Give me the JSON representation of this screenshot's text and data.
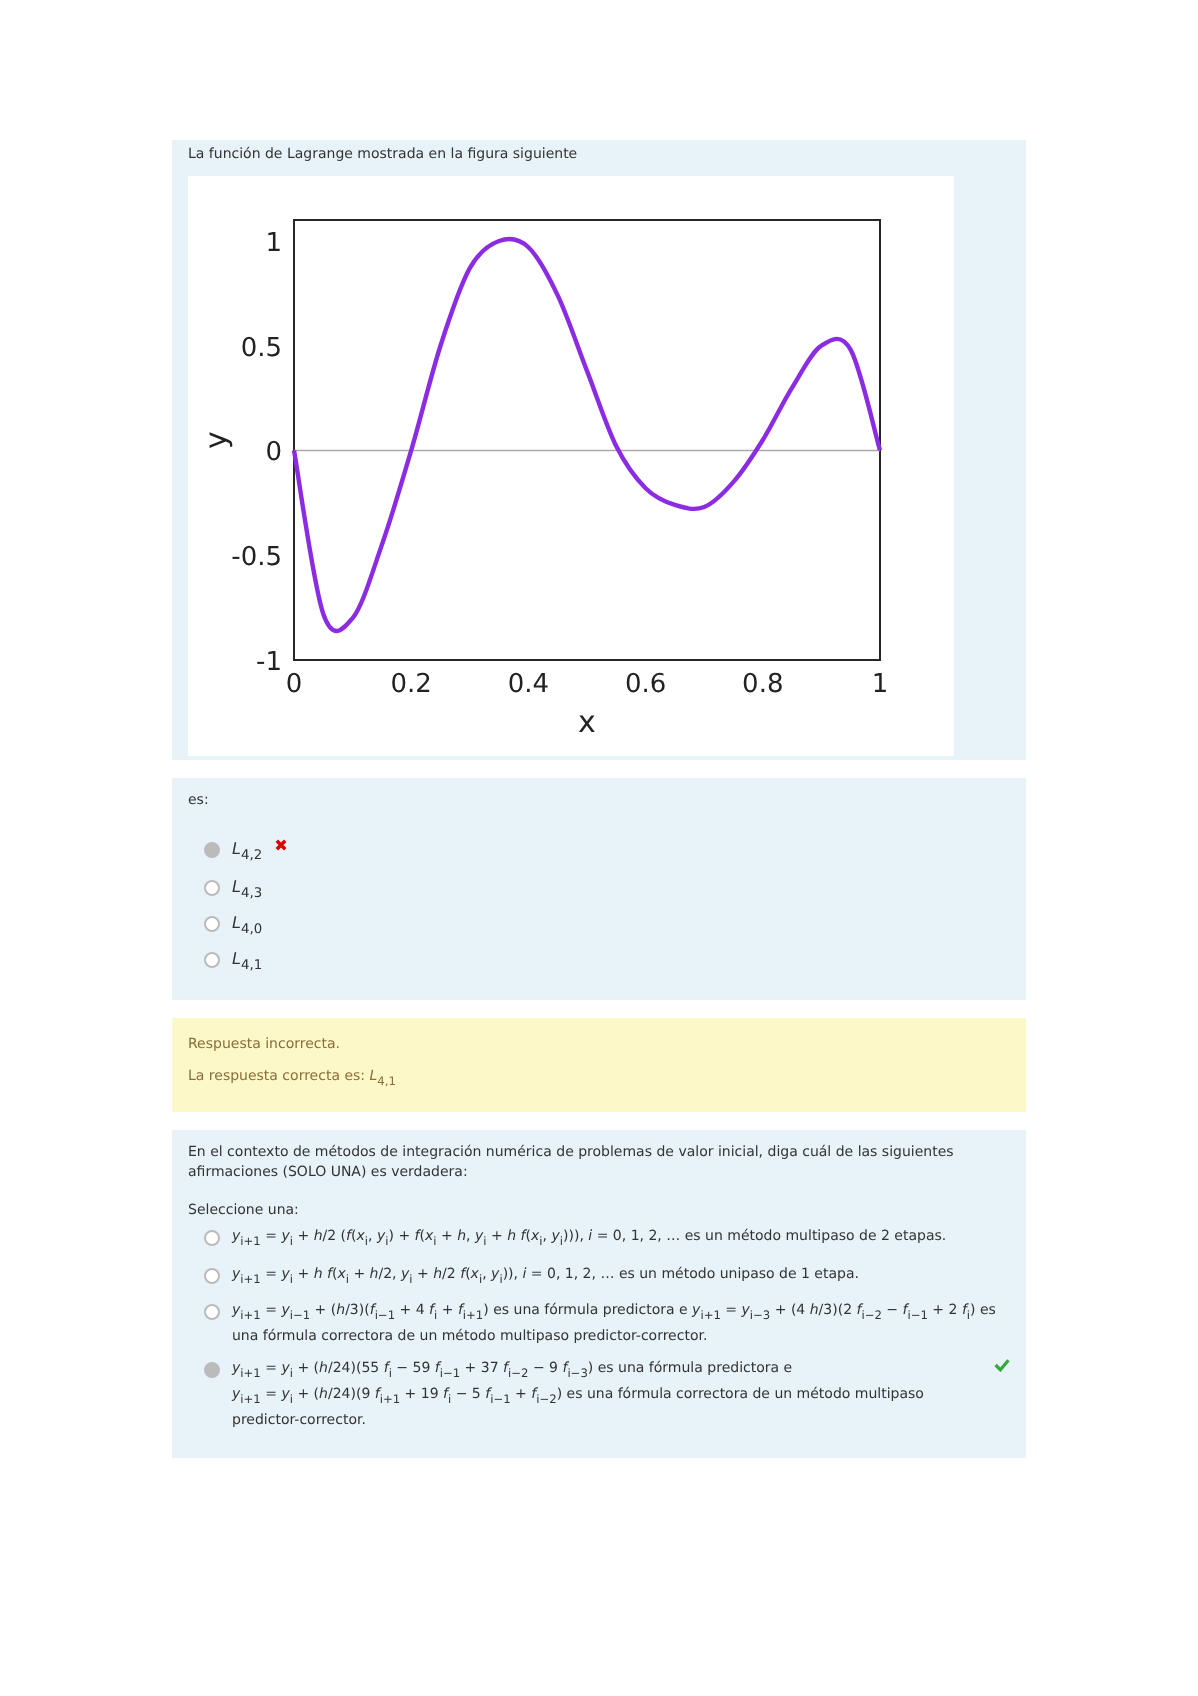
{
  "question_1": {
    "prompt": "La función de Lagrange mostrada en la figura siguiente",
    "figure": {
      "chart_data": {
        "type": "line",
        "xlabel": "x",
        "ylabel": "y",
        "x": [
          0,
          0.05,
          0.1,
          0.15,
          0.2,
          0.25,
          0.3,
          0.35,
          0.4,
          0.45,
          0.5,
          0.55,
          0.6,
          0.65,
          0.7,
          0.75,
          0.8,
          0.85,
          0.9,
          0.95,
          1
        ],
        "series": [
          {
            "color": "#8b2be2",
            "values": [
              0,
              -0.78,
              -0.8,
              -0.45,
              0,
              0.5,
              0.87,
              1.0,
              0.97,
              0.74,
              0.38,
              0.02,
              -0.18,
              -0.26,
              -0.27,
              -0.15,
              0.05,
              0.3,
              0.5,
              0.48,
              0
            ]
          }
        ],
        "xlim": [
          0,
          1
        ],
        "ylim": [
          -1,
          1.1
        ],
        "xticks": [
          0,
          0.2,
          0.4,
          0.6,
          0.8,
          1
        ],
        "yticks": [
          -1,
          -0.5,
          0,
          0.5,
          1
        ]
      }
    }
  },
  "question_1_answers": {
    "lead": "es:",
    "options": [
      {
        "text": "*L*$_{4,2}$",
        "selected": true,
        "marked_incorrect": true
      },
      {
        "text": "*L*$_{4,3}$",
        "selected": false,
        "marked_incorrect": false
      },
      {
        "text": "*L*$_{4,0}$",
        "selected": false,
        "marked_incorrect": false
      },
      {
        "text": "*L*$_{4,1}$",
        "selected": false,
        "marked_incorrect": false
      }
    ]
  },
  "feedback": {
    "status": "Respuesta incorrecta.",
    "correct_answer": "La respuesta correcta es: *L*$_{4,1}$"
  },
  "question_2": {
    "prompt": "En el contexto de métodos de integración numérica de problemas de valor inicial, diga cuál de las siguientes afirmaciones (SOLO UNA) es verdadera:",
    "instruction": "Seleccione una:",
    "options": [
      {
        "lines": [
          "*y*$_{i+1}$ = *y*$_{i}$ + *h*/2 (*f*(*x*$_{i}$, *y*$_{i}$) + *f*(*x*$_{i}$ + *h*, *y*$_{i}$ + *h f*(*x*$_{i}$, *y*$_{i}$))), *i* = 0, 1, 2, … es un método multipaso de 2 etapas."
        ],
        "selected": false,
        "marked_correct": false
      },
      {
        "lines": [
          "*y*$_{i+1}$ = *y*$_{i}$ + *h f*(*x*$_{i}$ + *h*/2, *y*$_{i}$ + *h*/2 *f*(*x*$_{i}$, *y*$_{i}$)), *i* = 0, 1, 2, … es un método unipaso de 1 etapa."
        ],
        "selected": false,
        "marked_correct": false
      },
      {
        "lines": [
          "*y*$_{i+1}$ = *y*$_{i−1}$ + (*h*/3)(*f*$_{i−1}$ + 4 *f*$_{i}$ + *f*$_{i+1}$) es una fórmula predictora e *y*$_{i+1}$ = *y*$_{i−3}$ + (4 *h*/3)(2 *f*$_{i−2}$ − *f*$_{i−1}$ + 2 *f*$_{i}$) es una fórmula correctora de un método multipaso predictor-corrector."
        ],
        "selected": false,
        "marked_correct": false
      },
      {
        "lines": [
          "*y*$_{i+1}$ = *y*$_{i}$ + (*h*/24)(55 *f*$_{i}$ − 59 *f*$_{i−1}$ + 37 *f*$_{i−2}$ − 9 *f*$_{i−3}$) es una fórmula predictora e",
          "*y*$_{i+1}$ = *y*$_{i}$ + (*h*/24)(9 *f*$_{i+1}$ + 19 *f*$_{i}$ − 5 *f*$_{i−1}$ + *f*$_{i−2}$) es una fórmula correctora de un método multipaso predictor-corrector."
        ],
        "selected": true,
        "marked_correct": true
      }
    ]
  }
}
